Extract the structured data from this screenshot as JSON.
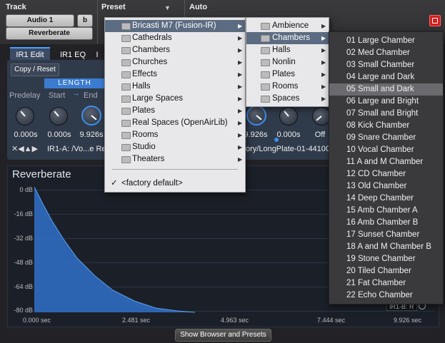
{
  "header": {
    "track_label": "Track",
    "preset_label": "Preset",
    "auto_label": "Auto",
    "track_name": "Audio 1",
    "track_suffix": "b",
    "insert_name": "Reverberate"
  },
  "tabs": [
    "IR1 Edit",
    "IR1 EQ",
    "I"
  ],
  "edit": {
    "copy_reset": "Copy / Reset",
    "length_title": "LENGTH",
    "predelay_label": "Predelay",
    "start_label": "Start",
    "end_label": "End",
    "knob_values_left": [
      "0.000s",
      "0.000s",
      "9.926s"
    ],
    "knob_values_right": [
      "9.926s",
      "0.000s",
      "Off"
    ],
    "ir_left_path": "IR1-A: /Vo...e Re",
    "ir_right_path": "ory/LongPlate-01-44100"
  },
  "graph": {
    "title": "Reverberate",
    "y_labels": [
      "0 dB",
      "-16 dB",
      "-32 dB",
      "-48 dB",
      "-64 dB",
      "-80 dB"
    ],
    "x_labels": [
      "0.000 sec",
      "2.481 sec",
      "4.963 sec",
      "7.444 sec",
      "9.926 sec"
    ],
    "ir_badge": "IR1-B: R"
  },
  "bottom_button": "Show Browser and Presets",
  "menu1": {
    "items": [
      {
        "label": "Bricasti M7 (Fusion-IR)",
        "arrow": true,
        "highlight": true
      },
      {
        "label": "Cathedrals",
        "arrow": true
      },
      {
        "label": "Chambers",
        "arrow": true
      },
      {
        "label": "Churches",
        "arrow": true
      },
      {
        "label": "Effects",
        "arrow": true
      },
      {
        "label": "Halls",
        "arrow": true
      },
      {
        "label": "Large Spaces",
        "arrow": true
      },
      {
        "label": "Plates",
        "arrow": true
      },
      {
        "label": "Real Spaces (OpenAirLib)",
        "arrow": true
      },
      {
        "label": "Rooms",
        "arrow": true
      },
      {
        "label": "Studio",
        "arrow": true
      },
      {
        "label": "Theaters",
        "arrow": true
      }
    ],
    "checked": "<factory default>",
    "checkmark": "✓"
  },
  "menu2": {
    "items": [
      {
        "label": "Ambience",
        "highlight": false
      },
      {
        "label": "Chambers",
        "highlight": true
      },
      {
        "label": "Halls",
        "highlight": false
      },
      {
        "label": "Nonlin",
        "highlight": false
      },
      {
        "label": "Plates",
        "highlight": false
      },
      {
        "label": "Rooms",
        "highlight": false
      },
      {
        "label": "Spaces",
        "highlight": false
      }
    ]
  },
  "menu3": {
    "items": [
      "01 Large Chamber",
      "02 Med Chamber",
      "03 Small Chamber",
      "04 Large and Dark",
      "05 Small and Dark",
      "06 Large and Bright",
      "07 Small and Bright",
      "08 Kick Chamber",
      "09 Snare Chamber",
      "10 Vocal Chamber",
      "11 A and M Chamber",
      "12 CD Chamber",
      "13 Old Chamber",
      "14 Deep Chamber",
      "15 Amb Chamber A",
      "16 Amb Chamber B",
      "17 Sunset Chamber",
      "18 A and M Chamber B",
      "19 Stone Chamber",
      "20 Tiled Chamber",
      "21 Fat Chamber",
      "22 Echo Chamber"
    ],
    "highlight_index": 4
  },
  "colors": {
    "accent": "#3b7bd0",
    "close": "#d02020",
    "menu_highlight": "#5a6b82"
  }
}
